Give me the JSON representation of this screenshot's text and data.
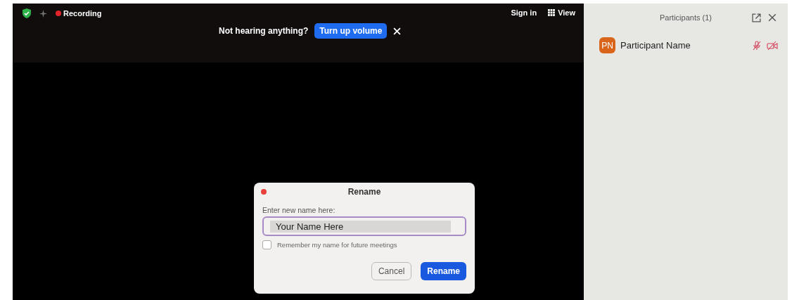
{
  "top_bar": {
    "recording": "Recording",
    "sign_in": "Sign in",
    "view": "View"
  },
  "notice": {
    "text": "Not hearing anything?",
    "button": "Turn up volume"
  },
  "dialog": {
    "title": "Rename",
    "label": "Enter new name here:",
    "value": "Your Name Here",
    "remember": {
      "label": "Remember my name for future meetings",
      "checked": false
    },
    "buttons": [
      {
        "label": "Cancel",
        "kind": "secondary"
      },
      {
        "label": "Rename",
        "kind": "primary"
      }
    ]
  },
  "participants": {
    "title": "Participants (1)",
    "items": [
      {
        "initials": "PN",
        "name": "Participant Name",
        "muted": true,
        "video_off": true
      }
    ]
  }
}
